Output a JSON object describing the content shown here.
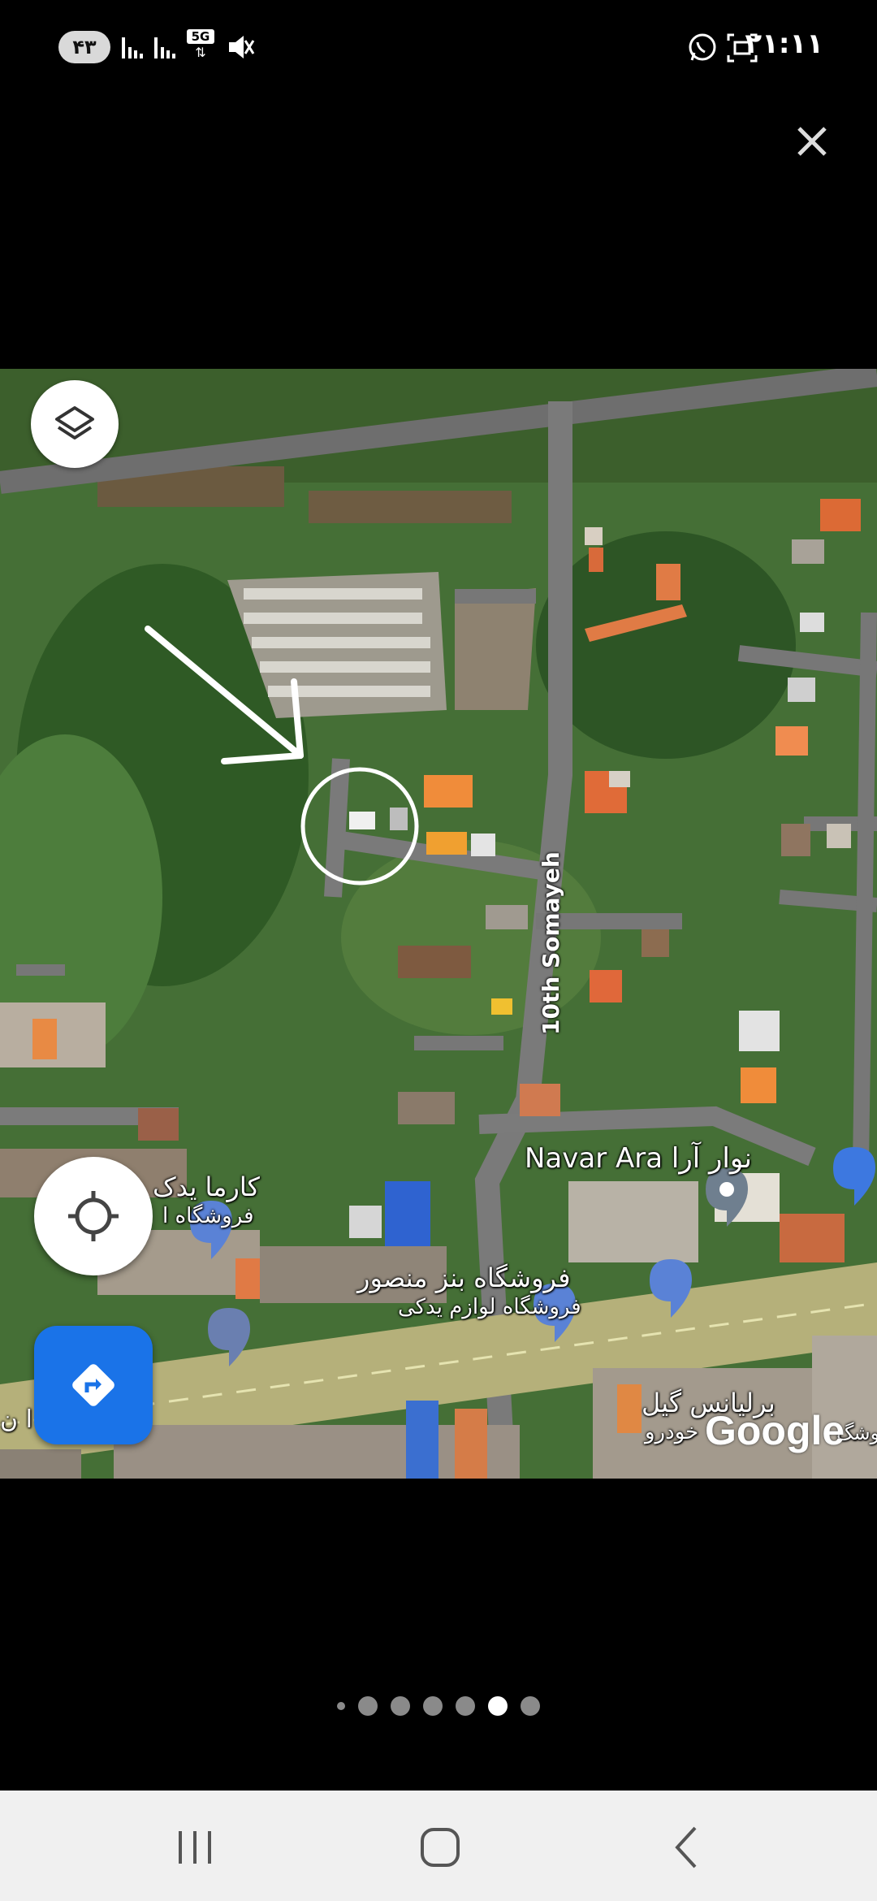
{
  "status_bar": {
    "battery": "۴۳",
    "network": "5G",
    "time": "۲۱:۱۱"
  },
  "viewer": {
    "close_icon": "close-icon"
  },
  "map": {
    "street_label": "10th Somayeh",
    "place_navar_ara": "Navar Ara نوار آرا",
    "place_karma": "کارما یدک",
    "place_karma_sub": "فروشگاه ا",
    "place_benz_mansour": "فروشگاه بنز منصور",
    "place_benz_mansour_sub": "فروشگاه لوازم یدکی",
    "place_brilliance": "برلیانس گیل",
    "place_brilliance_sub": "خودرو",
    "place_left_edge": "ا ن",
    "place_right_edge": "وشگ",
    "google_logo": "Google",
    "layers_icon": "layers-icon",
    "location_icon": "my-location-icon",
    "directions_icon": "directions-icon",
    "accent_color": "#1a73e8"
  },
  "pager": {
    "count": 7,
    "active_index": 5
  },
  "nav_bar": {
    "recents_icon": "recents-icon",
    "home_icon": "home-icon",
    "back_icon": "back-icon"
  }
}
